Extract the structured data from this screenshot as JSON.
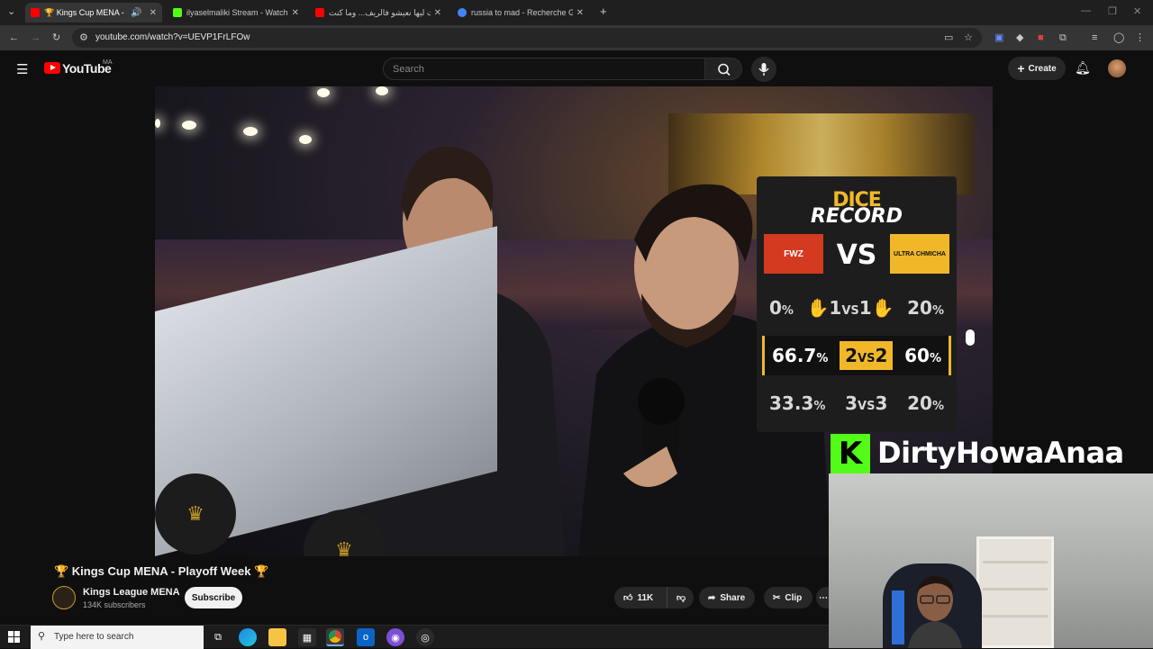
{
  "browser": {
    "tabs": [
      {
        "title": "🏆 Kings Cup MENA - Play",
        "favicon_color": "#ff0000",
        "active": true
      },
      {
        "title": "ilyaselmaliki Stream - Watch Li",
        "favicon_color": "#53fc18",
        "active": false
      },
      {
        "title": "قلت ليها نعيشو فالريف... وما كنت",
        "favicon_color": "#ff0000",
        "active": false
      },
      {
        "title": "russia to mad - Recherche Goo",
        "favicon_color": "#4285f4",
        "active": false
      }
    ],
    "new_tab_icon": "plus-icon",
    "url": "youtube.com/watch?v=UEVP1FrLFOw"
  },
  "youtube": {
    "logo_text": "YouTube",
    "region": "MA",
    "search_placeholder": "Search",
    "create_label": "Create"
  },
  "overlay": {
    "title_line1": "DICE",
    "title_line2": "RECORD",
    "team_left": "FWZ",
    "team_right": "ULTRA CHMICHA",
    "vs": "VS",
    "rows": [
      {
        "left_val": "0",
        "mid_a": "1",
        "mid_vs": "VS",
        "mid_b": "1",
        "right_val": "20",
        "highlight": false
      },
      {
        "left_val": "66.7",
        "mid_a": "2",
        "mid_vs": "VS",
        "mid_b": "2",
        "right_val": "60",
        "highlight": true
      },
      {
        "left_val": "33.3",
        "mid_a": "3",
        "mid_vs": "VS",
        "mid_b": "3",
        "right_val": "20",
        "highlight": false
      }
    ],
    "pct": "%",
    "accent": "#f0b828"
  },
  "streamer": {
    "kick_logo": "K",
    "name": "DirtyHowaAnaa",
    "kick_color": "#53fc18"
  },
  "video_info": {
    "title": "🏆 Kings Cup MENA - Playoff Week 🏆",
    "channel": "Kings League MENA",
    "subscribers": "134K subscribers",
    "subscribe_label": "Subscribe",
    "likes": "11K",
    "share_label": "Share",
    "clip_label": "Clip"
  },
  "taskbar": {
    "search_placeholder": "Type here to search"
  }
}
